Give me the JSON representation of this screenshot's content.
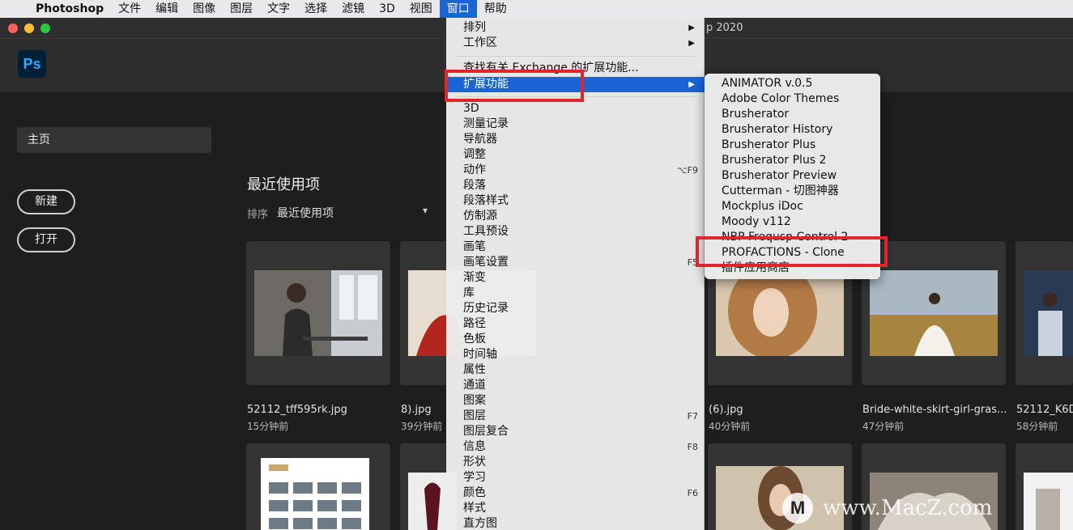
{
  "menubar": {
    "apple_icon": "apple-icon",
    "app_name": "Photoshop",
    "items": [
      "文件",
      "编辑",
      "图像",
      "图层",
      "文字",
      "选择",
      "滤镜",
      "3D",
      "视图",
      "窗口",
      "帮助"
    ],
    "active_item": "窗口"
  },
  "window": {
    "title_fragment": "p 2020"
  },
  "app": {
    "logo_text": "Ps"
  },
  "sidebar": {
    "home": "主页",
    "new_button": "新建",
    "open_button": "打开"
  },
  "main": {
    "recent_title": "最近使用项",
    "sort_label": "排序",
    "sort_value": "最近使用项",
    "files": [
      {
        "name": "52112_tff595rk.jpg",
        "time": "15分钟前"
      },
      {
        "name": "8).jpg",
        "time": "39分钟前"
      },
      {
        "name": "(6).jpg",
        "time": "40分钟前"
      },
      {
        "name": "Bride-white-skirt-girl-gras...",
        "time": "47分钟前"
      },
      {
        "name": "52112_K6D",
        "time": "58分钟前"
      }
    ]
  },
  "window_menu": {
    "items": [
      {
        "label": "排列",
        "submenu": true
      },
      {
        "label": "工作区",
        "submenu": true
      },
      {
        "label": "查找有关 Exchange 的扩展功能..."
      },
      {
        "label": "扩展功能",
        "submenu": true,
        "highlighted": true
      },
      {
        "label": "3D"
      },
      {
        "label": "测量记录"
      },
      {
        "label": "导航器"
      },
      {
        "label": "调整"
      },
      {
        "label": "动作",
        "shortcut": "⌥F9"
      },
      {
        "label": "段落"
      },
      {
        "label": "段落样式"
      },
      {
        "label": "仿制源"
      },
      {
        "label": "工具预设"
      },
      {
        "label": "画笔"
      },
      {
        "label": "画笔设置",
        "shortcut": "F5"
      },
      {
        "label": "渐变"
      },
      {
        "label": "库"
      },
      {
        "label": "历史记录"
      },
      {
        "label": "路径"
      },
      {
        "label": "色板"
      },
      {
        "label": "时间轴"
      },
      {
        "label": "属性"
      },
      {
        "label": "通道"
      },
      {
        "label": "图案"
      },
      {
        "label": "图层",
        "shortcut": "F7"
      },
      {
        "label": "图层复合"
      },
      {
        "label": "信息",
        "shortcut": "F8"
      },
      {
        "label": "形状"
      },
      {
        "label": "学习"
      },
      {
        "label": "颜色",
        "shortcut": "F6"
      },
      {
        "label": "样式"
      },
      {
        "label": "直方图"
      }
    ]
  },
  "extensions_submenu": {
    "items": [
      "ANIMATOR v.0.5",
      "Adobe Color Themes",
      "Brusherator",
      "Brusherator History",
      "Brusherator Plus",
      "Brusherator Plus 2",
      "Brusherator Preview",
      "Cutterman - 切图神器",
      "Mockplus iDoc",
      "Moody v112",
      "NBP Frequsp Control 2",
      "PROFACTIONS - Clone",
      "插件应用商店"
    ]
  },
  "watermark": {
    "logo": "M",
    "text": "www.MacZ.com"
  },
  "colors": {
    "menu_highlight": "#1a64d6",
    "annotation_red": "#e0262b",
    "ps_blue": "#31a8ff"
  }
}
